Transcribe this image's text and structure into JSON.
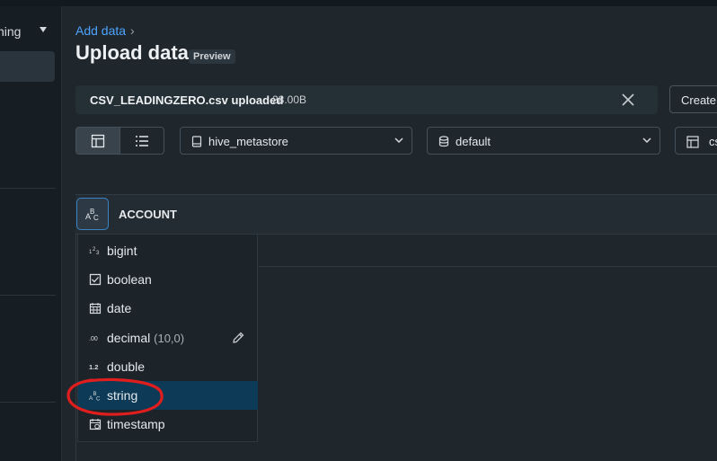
{
  "sidebar": {
    "top_item": "ning"
  },
  "breadcrumb": {
    "link": "Add data",
    "sep": "›"
  },
  "page": {
    "title": "Upload data",
    "badge": "Preview"
  },
  "upload": {
    "filename": "CSV_LEADINGZERO.csv uploaded",
    "size": "28.00B"
  },
  "toolbar": {
    "create_label": "Create"
  },
  "selects": {
    "catalog": "hive_metastore",
    "schema": "default",
    "table": "cs"
  },
  "column": {
    "name": "ACCOUNT"
  },
  "type_menu": {
    "items": [
      {
        "label": "bigint",
        "icon": "123"
      },
      {
        "label": "boolean",
        "icon": "☑"
      },
      {
        "label": "date",
        "icon": "▦"
      },
      {
        "label": "decimal",
        "extra": "(10,0)",
        "icon": ".00"
      },
      {
        "label": "double",
        "icon": "1.2"
      },
      {
        "label": "string",
        "icon": "ABC"
      },
      {
        "label": "timestamp",
        "icon": "▦"
      }
    ],
    "selected": "string"
  },
  "colors": {
    "accent": "#4da3ff",
    "selected_bg": "#0d3a56",
    "annotation": "#e01e1e"
  }
}
